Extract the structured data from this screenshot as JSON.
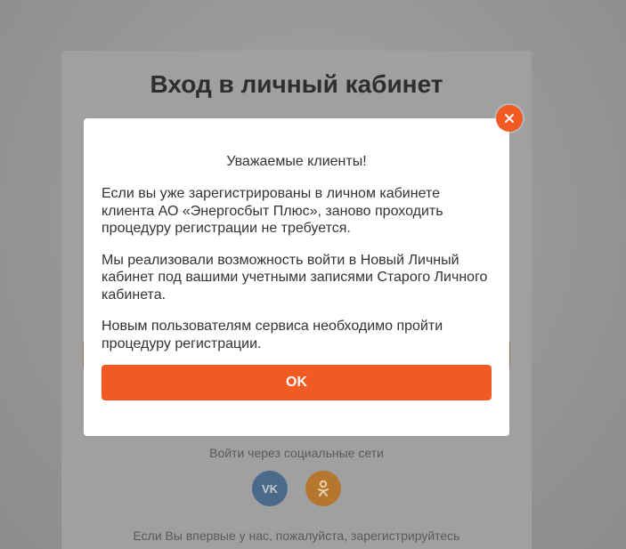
{
  "background": {
    "title": "Вход в личный кабинет",
    "social_label": "Войти через социальные сети",
    "social_buttons": [
      {
        "icon": "vk-icon",
        "label": "VK"
      },
      {
        "icon": "ok-icon",
        "label": "ОК"
      }
    ],
    "register_text": "Если Вы впервые у нас, пожалуйста, зарегистрируйтесь"
  },
  "modal": {
    "heading": "Уважаемые клиенты!",
    "paragraphs": [
      "Если вы уже зарегистрированы в личном кабинете клиента АО «Энергосбыт Плюс», заново проходить процедуру регистрации не требуется.",
      "Мы реализовали возможность войти в Новый Личный кабинет под вашими учетными записями Старого Личного кабинета.",
      "Новым пользователям сервиса необходимо пройти процедуру регистрации."
    ],
    "ok_label": "OK",
    "close_icon": "close-icon"
  },
  "colors": {
    "accent": "#f15a22",
    "overlay": "#9a9a9a"
  }
}
